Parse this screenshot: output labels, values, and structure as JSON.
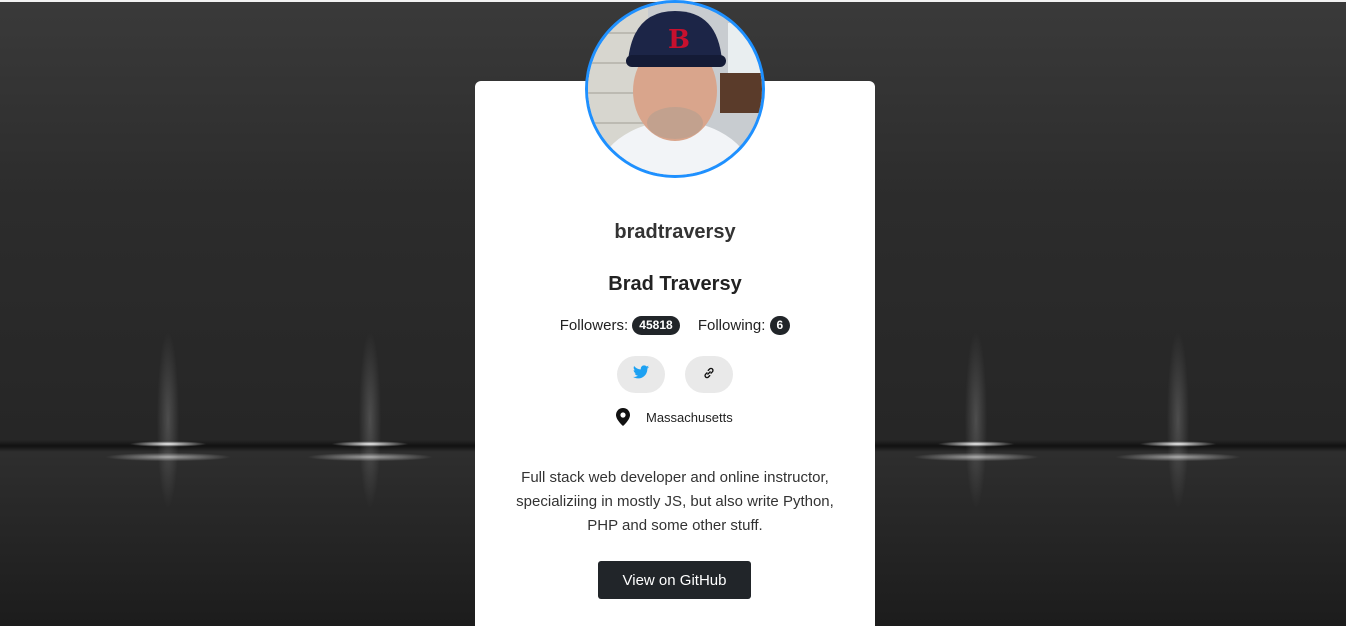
{
  "profile": {
    "login": "bradtraversy",
    "name": "Brad Traversy",
    "followers_label": "Followers:",
    "followers_count": "45818",
    "following_label": "Following:",
    "following_count": "6",
    "location": "Massachusetts",
    "bio": "Full stack web developer and online instructor, specializiing in mostly JS, but also write Python, PHP and some other stuff.",
    "github_button_label": "View on GitHub"
  },
  "icons": {
    "twitter": "twitter-icon",
    "link": "link-icon",
    "location": "map-pin-icon"
  },
  "colors": {
    "avatar_border": "#1e90ff",
    "twitter_blue": "#1da1f2",
    "button_dark": "#212529",
    "card_bg": "#ffffff"
  }
}
